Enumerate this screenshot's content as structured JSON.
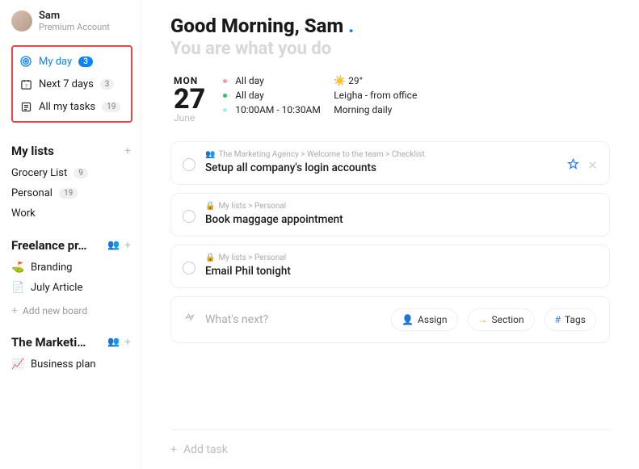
{
  "user": {
    "name": "Sam",
    "subtitle": "Premium Account"
  },
  "nav": {
    "myday": {
      "label": "My day",
      "count": "3"
    },
    "next7": {
      "label": "Next 7 days",
      "count": "3"
    },
    "alltasks": {
      "label": "All my tasks",
      "count": "19"
    }
  },
  "sections": {
    "mylists": {
      "title": "My lists",
      "items": [
        {
          "label": "Grocery List",
          "count": "9"
        },
        {
          "label": "Personal",
          "count": "19"
        },
        {
          "label": "Work"
        }
      ]
    },
    "freelance": {
      "title": "Freelance pr…",
      "items": [
        {
          "emoji": "⛳",
          "label": "Branding"
        },
        {
          "emoji": "📄",
          "label": "July Article"
        }
      ],
      "add_label": "Add new board"
    },
    "marketing": {
      "title": "The Marketi…",
      "items": [
        {
          "emoji": "📈",
          "label": "Business plan"
        }
      ]
    }
  },
  "greeting_line1": "Good Morning, Sam",
  "greeting_line2": "You are what you do",
  "date": {
    "dow": "MON",
    "num": "27",
    "month": "June"
  },
  "events": [
    {
      "dot": "#ef9aa2",
      "time": "All day",
      "label": "☀️ 29°"
    },
    {
      "dot": "#22c55e",
      "time": "All day",
      "label": "Leigha - from office"
    },
    {
      "dot": "#a5f3d7",
      "time": "10:00AM - 10:30AM",
      "label": "Morning daily"
    }
  ],
  "tasks": [
    {
      "crumb_icon": "👥",
      "crumb": "The Marketing Agency > Welcome to the team > Checklist",
      "title": "Setup all company's login accounts",
      "pinned": true
    },
    {
      "crumb_icon": "🔒",
      "crumb": "My lists > Personal",
      "title": "Book maggage appointment"
    },
    {
      "crumb_icon": "🔒",
      "crumb": "My lists > Personal",
      "title": "Email Phil tonight"
    }
  ],
  "next_placeholder": "What's next?",
  "chips": {
    "assign": "Assign",
    "section": "Section",
    "tags": "Tags"
  },
  "bottom_add": "Add task"
}
